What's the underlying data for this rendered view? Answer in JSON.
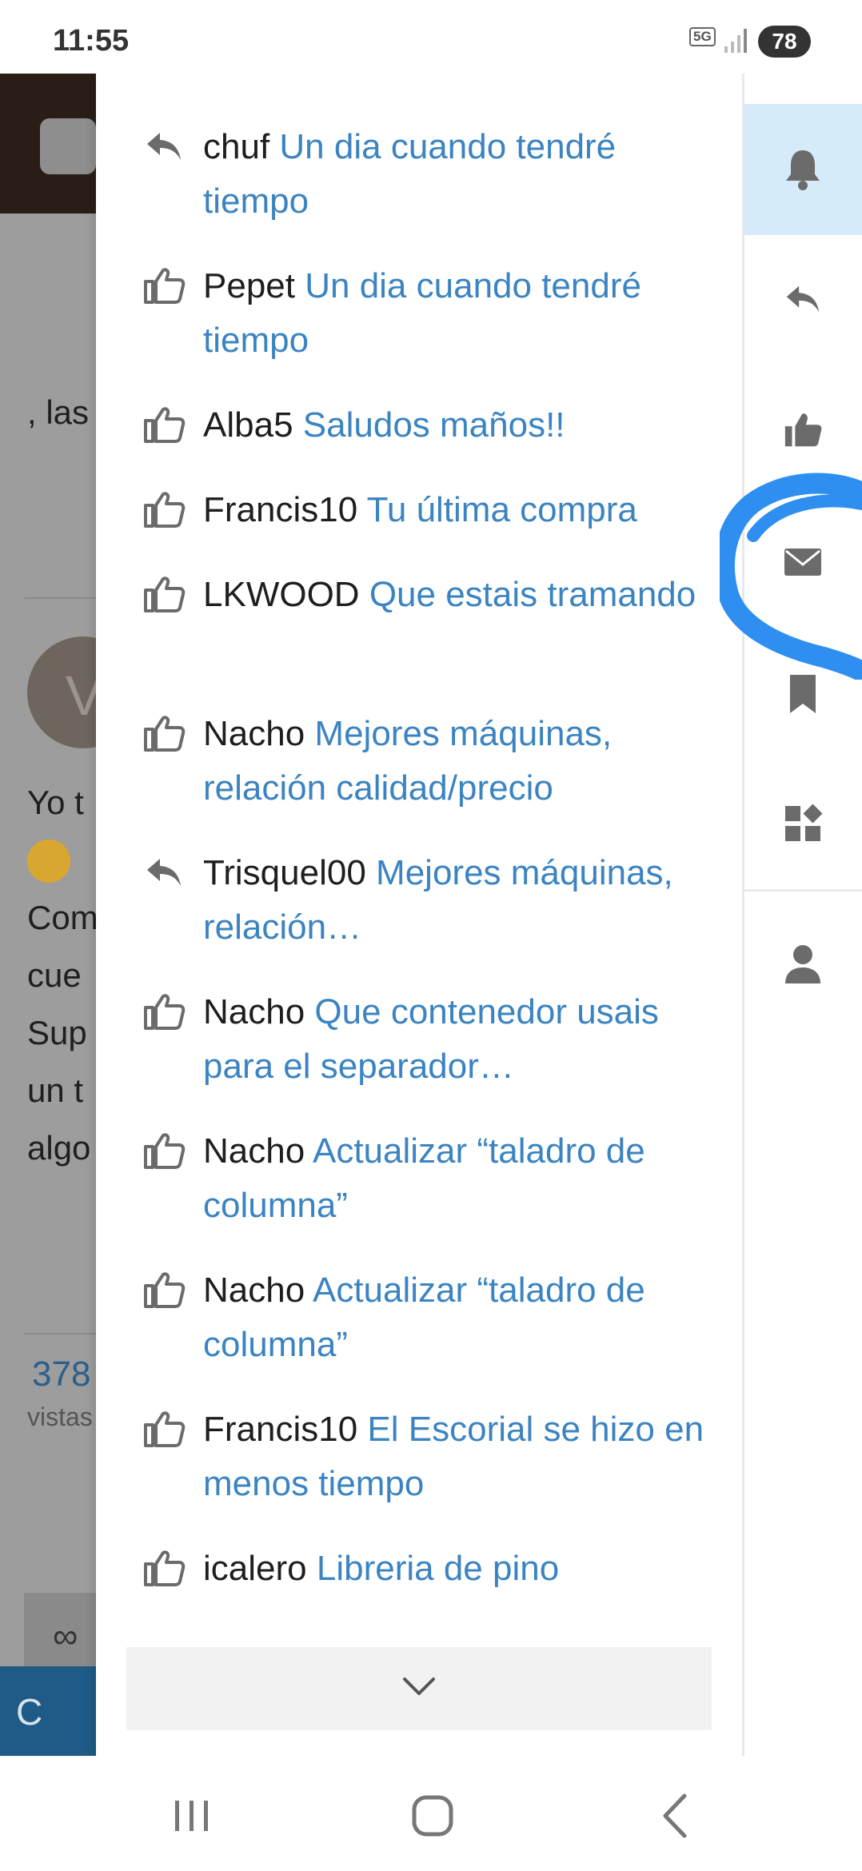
{
  "status_bar": {
    "time": "11:55",
    "network": "5G",
    "battery": "78"
  },
  "background_page": {
    "text_fragments": [
      ", las",
      "Yo t",
      "Com",
      "cue",
      "Sup",
      "un t",
      "algo"
    ],
    "avatar_letter": "V",
    "stat_value": "378",
    "stat_label": "vistas",
    "reply_label": "C"
  },
  "notifications": [
    {
      "type": "reply-icon",
      "user": "chuf",
      "topic": "Un dia cuando tendré tiempo"
    },
    {
      "type": "like-icon",
      "user": "Pepet",
      "topic": "Un dia cuando tendré tiempo"
    },
    {
      "type": "like-icon",
      "user": "Alba5",
      "topic": "Saludos maños!!"
    },
    {
      "type": "like-icon",
      "user": "Francis10",
      "topic": "Tu última compra"
    },
    {
      "type": "like-icon",
      "user": "LKWOOD",
      "topic": "Que estais tramando"
    },
    {
      "type": "like-icon",
      "user": "Nacho",
      "topic": "Mejores máquinas, relación calidad/precio"
    },
    {
      "type": "reply-icon",
      "user": "Trisquel00",
      "topic": "Mejores máquinas, relación…"
    },
    {
      "type": "like-icon",
      "user": "Nacho",
      "topic": "Que contenedor usais para el separador…"
    },
    {
      "type": "like-icon",
      "user": "Nacho",
      "topic": "Actualizar “taladro de columna”"
    },
    {
      "type": "like-icon",
      "user": "Nacho",
      "topic": "Actualizar “taladro de columna”"
    },
    {
      "type": "like-icon",
      "user": "Francis10",
      "topic": "El Escorial se hizo en menos tiempo"
    },
    {
      "type": "like-icon",
      "user": "icalero",
      "topic": "Libreria de pino"
    }
  ],
  "rail_tabs": [
    {
      "name": "bell-icon",
      "active": true
    },
    {
      "name": "reply-icon",
      "active": false
    },
    {
      "name": "like-icon",
      "active": false
    },
    {
      "name": "envelope-icon",
      "active": false
    },
    {
      "name": "bookmark-icon",
      "active": false
    },
    {
      "name": "widgets-icon",
      "active": false
    },
    {
      "name": "user-icon",
      "active": false
    }
  ],
  "colors": {
    "link": "#3b84c1",
    "active_tab": "#d6ebfa",
    "scribble": "#2e8ff0",
    "icon": "#6b6b6b"
  }
}
